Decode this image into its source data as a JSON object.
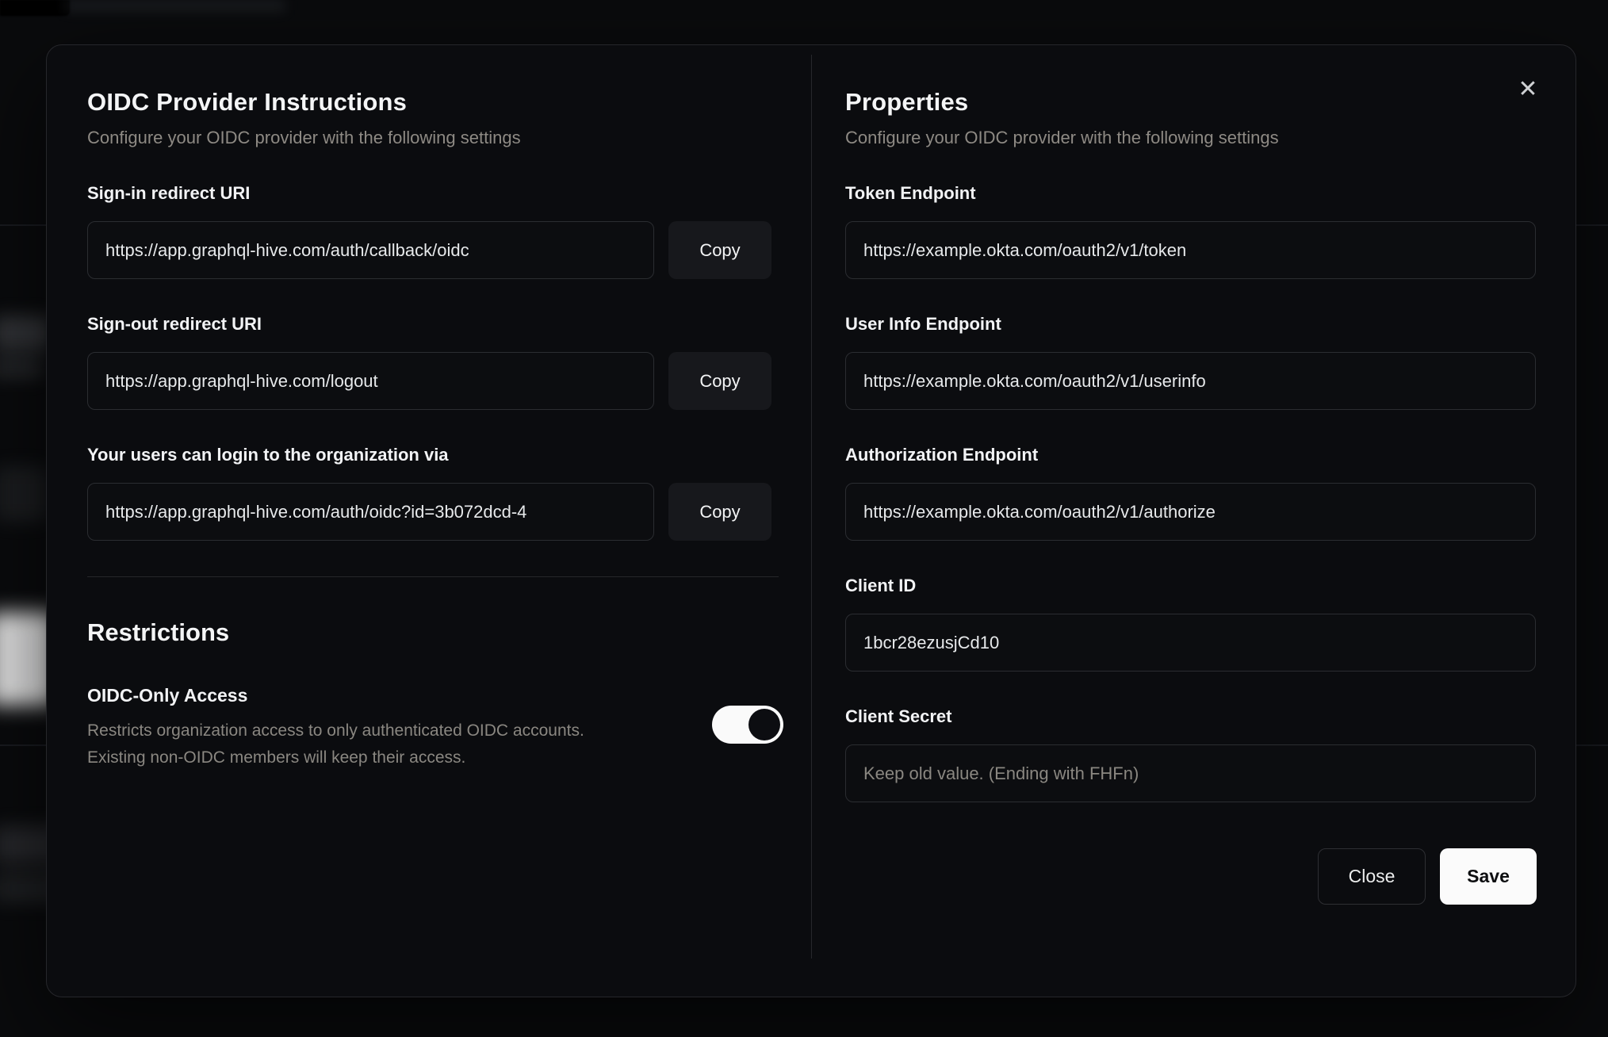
{
  "modal": {
    "close_icon": "✕",
    "left": {
      "title": "OIDC Provider Instructions",
      "subtitle": "Configure your OIDC provider with the following settings",
      "fields": [
        {
          "label": "Sign-in redirect URI",
          "value": "https://app.graphql-hive.com/auth/callback/oidc",
          "copy_label": "Copy"
        },
        {
          "label": "Sign-out redirect URI",
          "value": "https://app.graphql-hive.com/logout",
          "copy_label": "Copy"
        },
        {
          "label": "Your users can login to the organization via",
          "value": "https://app.graphql-hive.com/auth/oidc?id=3b072dcd-4",
          "copy_label": "Copy"
        }
      ],
      "restrictions": {
        "title": "Restrictions",
        "toggle_label": "OIDC-Only Access",
        "description_line1": "Restricts organization access to only authenticated OIDC accounts.",
        "description_line2": "Existing non-OIDC members will keep their access.",
        "toggle_state": "true"
      }
    },
    "right": {
      "title": "Properties",
      "subtitle": "Configure your OIDC provider with the following settings",
      "fields": [
        {
          "label": "Token Endpoint",
          "value": "https://example.okta.com/oauth2/v1/token"
        },
        {
          "label": "User Info Endpoint",
          "value": "https://example.okta.com/oauth2/v1/userinfo"
        },
        {
          "label": "Authorization Endpoint",
          "value": "https://example.okta.com/oauth2/v1/authorize"
        },
        {
          "label": "Client ID",
          "value": "1bcr28ezusjCd10"
        },
        {
          "label": "Client Secret",
          "value": "",
          "placeholder": "Keep old value. (Ending with FHFn)"
        }
      ],
      "buttons": {
        "close": "Close",
        "save": "Save"
      }
    }
  },
  "colors": {
    "modal_background": "#0b0c0f",
    "input_border": "#2b2d31",
    "copy_button_background": "#17181c",
    "muted_text": "#8e8a84",
    "primary_text": "#f4f5f6",
    "save_button_background": "#fbfbfb",
    "toggle_track": "#fafafa"
  }
}
